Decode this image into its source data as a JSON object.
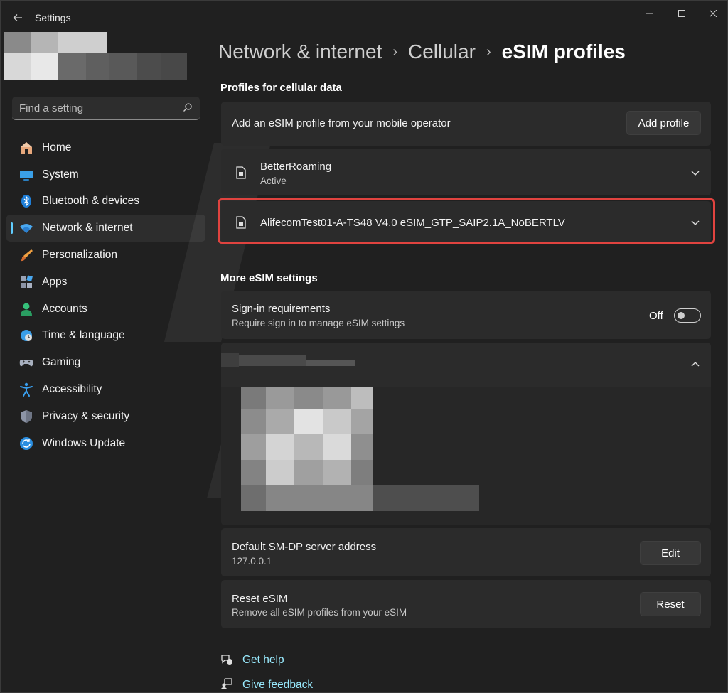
{
  "window": {
    "title": "Settings"
  },
  "search": {
    "placeholder": "Find a setting"
  },
  "sidebar": {
    "items": [
      {
        "label": "Home",
        "icon": "home-icon"
      },
      {
        "label": "System",
        "icon": "monitor-icon"
      },
      {
        "label": "Bluetooth & devices",
        "icon": "bluetooth-icon"
      },
      {
        "label": "Network & internet",
        "icon": "wifi-icon",
        "active": true
      },
      {
        "label": "Personalization",
        "icon": "brush-icon"
      },
      {
        "label": "Apps",
        "icon": "apps-icon"
      },
      {
        "label": "Accounts",
        "icon": "person-icon"
      },
      {
        "label": "Time & language",
        "icon": "globe-clock-icon"
      },
      {
        "label": "Gaming",
        "icon": "gamepad-icon"
      },
      {
        "label": "Accessibility",
        "icon": "accessibility-icon"
      },
      {
        "label": "Privacy & security",
        "icon": "shield-icon"
      },
      {
        "label": "Windows Update",
        "icon": "update-icon"
      }
    ]
  },
  "breadcrumb": {
    "items": [
      "Network & internet",
      "Cellular",
      "eSIM profiles"
    ],
    "separator": "›"
  },
  "profiles_section": {
    "title": "Profiles for cellular data",
    "add_card": {
      "label": "Add an eSIM profile from your mobile operator",
      "button": "Add profile"
    },
    "profiles": [
      {
        "name": "BetterRoaming",
        "status": "Active"
      },
      {
        "name": "AlifecomTest01-A-TS48 V4.0 eSIM_GTP_SAIP2.1A_NoBERTLV",
        "status": ""
      }
    ]
  },
  "more_section": {
    "title": "More eSIM settings",
    "sign_in": {
      "title": "Sign-in requirements",
      "subtitle": "Require sign in to manage eSIM settings",
      "toggle_label": "Off",
      "toggle_on": false
    },
    "smdp": {
      "title": "Default SM-DP server address",
      "value": "127.0.0.1",
      "button": "Edit"
    },
    "reset": {
      "title": "Reset eSIM",
      "subtitle": "Remove all eSIM profiles from your eSIM",
      "button": "Reset"
    }
  },
  "footer_links": {
    "help": "Get help",
    "feedback": "Give feedback"
  },
  "colors": {
    "accent": "#60cdff",
    "link": "#99ebff",
    "highlight": "#e0433f",
    "background": "#202020",
    "card": "#2b2b2b"
  }
}
